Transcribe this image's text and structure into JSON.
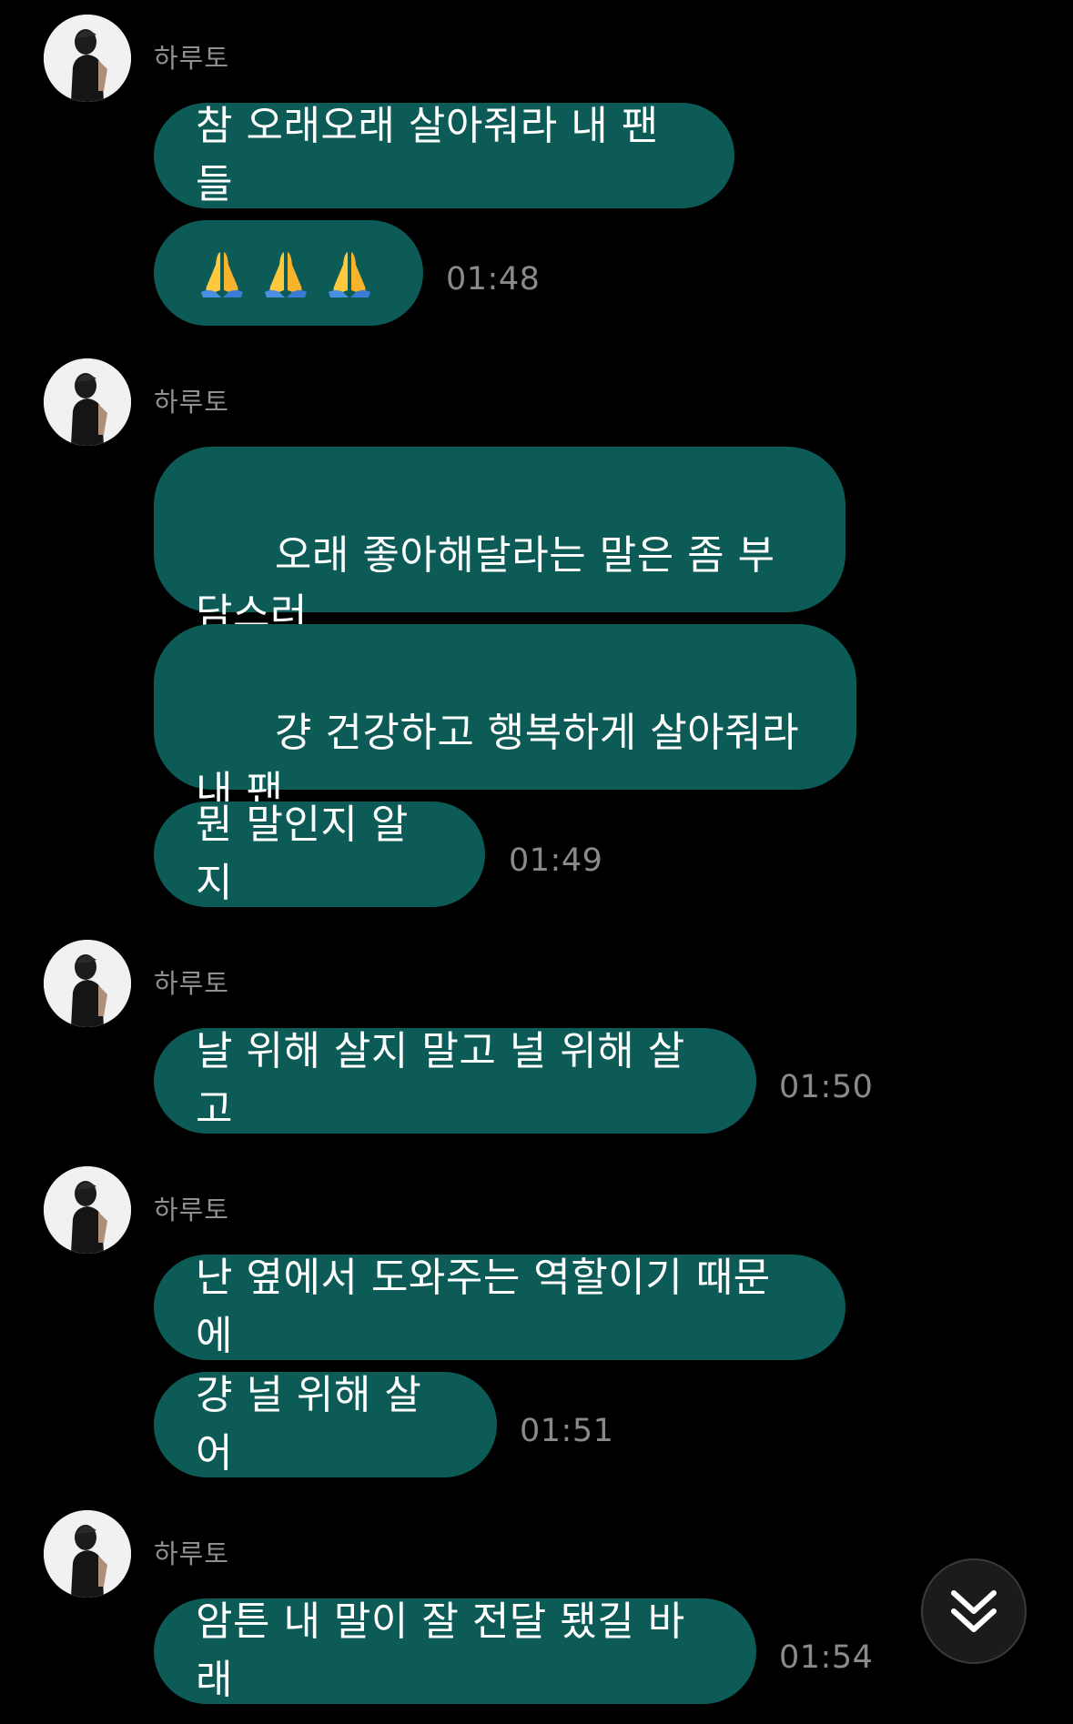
{
  "chat": {
    "groups": [
      {
        "sender": "하루토",
        "messages": [
          {
            "text": "참 오래오래 살아줘라 내 팬들"
          },
          {
            "emoji": [
              "pray-emoji",
              "pray-emoji",
              "pray-emoji"
            ]
          }
        ],
        "time": "01:48"
      },
      {
        "sender": "하루토",
        "messages": [
          {
            "text": "오래 좋아해달라는 말은 좀 부담스러\n울 수가 있으니"
          },
          {
            "text": "걍 건강하고 행복하게 살아줘라 내 팬\n들만큼은"
          },
          {
            "text": "뭔 말인지 알지"
          }
        ],
        "time": "01:49"
      },
      {
        "sender": "하루토",
        "messages": [
          {
            "text": "날 위해 살지 말고 널 위해 살고"
          }
        ],
        "time": "01:50"
      },
      {
        "sender": "하루토",
        "messages": [
          {
            "text": "난 옆에서 도와주는 역할이기 때문에"
          },
          {
            "text": "걍 널 위해 살어"
          }
        ],
        "time": "01:51"
      },
      {
        "sender": "하루토",
        "messages": [
          {
            "text": "암튼 내 말이 잘 전달 됐길 바래"
          }
        ],
        "time": "01:54"
      }
    ]
  },
  "scroll_button": {
    "icon": "double-chevron-down-icon"
  },
  "colors": {
    "background": "#000000",
    "bubble": "#0d5b57",
    "bubble_text": "#ffffff",
    "sender_text": "#8f8f8f",
    "time_text": "#8a8a8a"
  }
}
